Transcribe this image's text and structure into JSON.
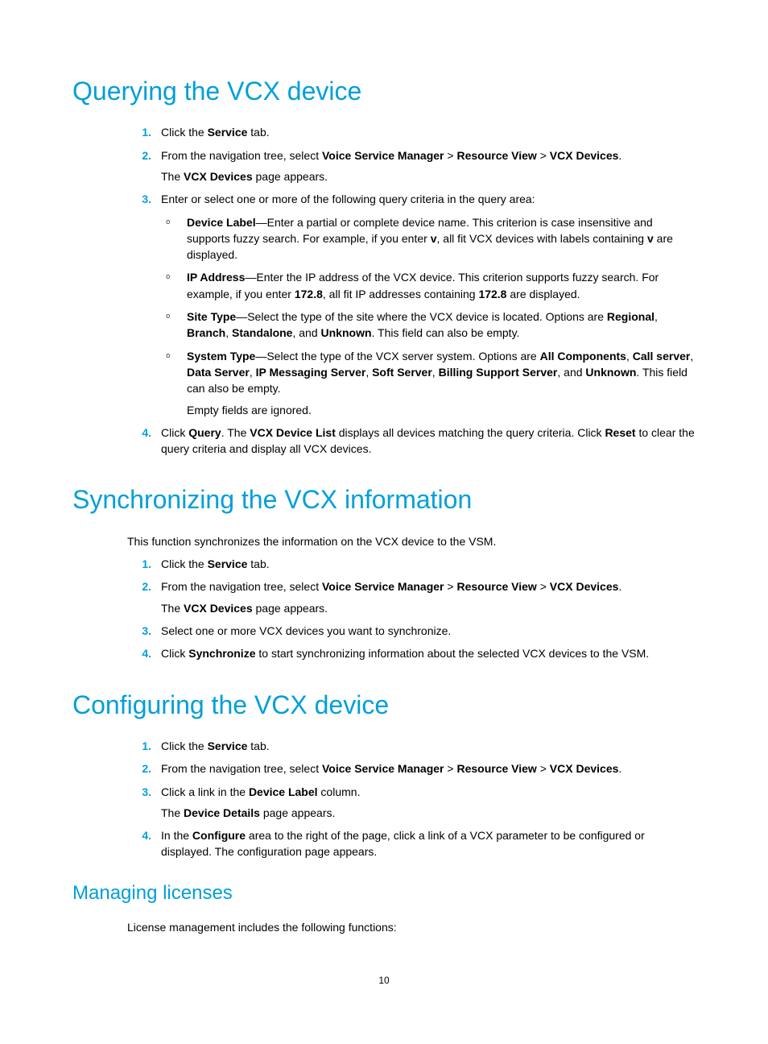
{
  "sections": {
    "querying": {
      "heading": "Querying the VCX device",
      "steps": [
        {
          "num": "1",
          "lines": [
            "Click the <b>Service</b> tab."
          ]
        },
        {
          "num": "2",
          "lines": [
            "From the navigation tree, select <b>Voice Service Manager</b> > <b>Resource View</b> > <b>VCX Devices</b>.",
            "The <b>VCX Devices</b> page appears."
          ]
        },
        {
          "num": "3",
          "lines": [
            "Enter or select one or more of the following query criteria in the query area:"
          ],
          "sub": [
            [
              "<b>Device Label</b>—Enter a partial or complete device name. This criterion is case insensitive and supports fuzzy search. For example, if you enter <b>v</b>, all fit VCX devices with labels containing <b>v</b> are displayed."
            ],
            [
              "<b>IP Address</b>—Enter the IP address of the VCX device. This criterion supports fuzzy search. For example, if you enter <b>172.8</b>, all fit IP addresses containing <b>172.8</b> are displayed."
            ],
            [
              "<b>Site Type</b>—Select the type of the site where the VCX device is located. Options are <b>Regional</b>, <b>Branch</b>, <b>Standalone</b>, and <b>Unknown</b>. This field can also be empty."
            ],
            [
              "<b>System Type</b>—Select the type of the VCX server system. Options are <b>All Components</b>, <b>Call server</b>, <b>Data Server</b>, <b>IP Messaging Server</b>, <b>Soft Server</b>, <b>Billing Support Server</b>, and <b>Unknown</b>. This field can also be empty.",
              "Empty fields are ignored."
            ]
          ]
        },
        {
          "num": "4",
          "lines": [
            "Click <b>Query</b>. The <b>VCX Device List</b> displays all devices matching the query criteria. Click <b>Reset</b> to clear the query criteria and display all VCX devices."
          ]
        }
      ]
    },
    "synchronizing": {
      "heading": "Synchronizing the VCX information",
      "intro": "This function synchronizes the information on the VCX device to the VSM.",
      "steps": [
        {
          "num": "1",
          "lines": [
            "Click the <b>Service</b> tab."
          ]
        },
        {
          "num": "2",
          "lines": [
            "From the navigation tree, select <b>Voice Service Manager</b> > <b>Resource View</b> > <b>VCX Devices</b>.",
            "The <b>VCX Devices</b> page appears."
          ]
        },
        {
          "num": "3",
          "lines": [
            "Select one or more VCX devices you want to synchronize."
          ]
        },
        {
          "num": "4",
          "lines": [
            "Click <b>Synchronize</b> to start synchronizing information about the selected VCX devices to the VSM."
          ]
        }
      ]
    },
    "configuring": {
      "heading": "Configuring the VCX device",
      "steps": [
        {
          "num": "1",
          "lines": [
            "Click the <b>Service</b> tab."
          ]
        },
        {
          "num": "2",
          "lines": [
            "From the navigation tree, select <b>Voice Service Manager</b> > <b>Resource View</b> > <b>VCX Devices</b>."
          ]
        },
        {
          "num": "3",
          "lines": [
            "Click a link in the <b>Device Label</b> column.",
            "The <b>Device Details</b> page appears."
          ]
        },
        {
          "num": "4",
          "lines": [
            "In the <b>Configure</b> area to the right of the page, click a link of a VCX parameter to be configured or displayed. The configuration page appears."
          ]
        }
      ]
    },
    "licenses": {
      "heading": "Managing licenses",
      "intro": "License management includes the following functions:"
    }
  },
  "page_number": "10"
}
